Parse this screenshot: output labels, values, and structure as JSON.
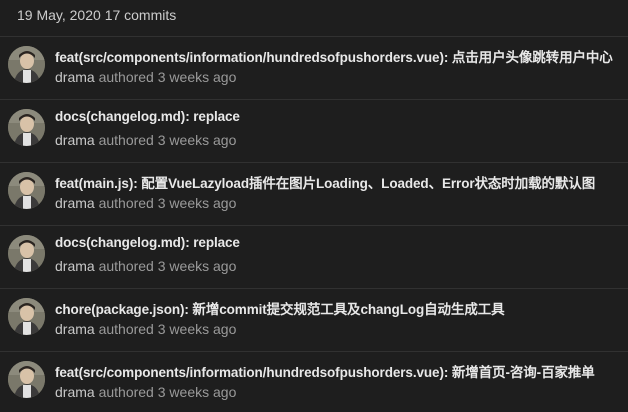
{
  "group": {
    "date": "19 May, 2020",
    "count": "17 commits"
  },
  "commits": [
    {
      "message": "feat(src/components/information/hundredsofpushorders.vue): 点击用户头像跳转用户中心",
      "author": "drama",
      "verb": "authored",
      "time": "3 weeks ago"
    },
    {
      "message": "docs(changelog.md): replace",
      "author": "drama",
      "verb": "authored",
      "time": "3 weeks ago"
    },
    {
      "message": "feat(main.js): 配置VueLazyload插件在图片Loading、Loaded、Error状态时加载的默认图",
      "author": "drama",
      "verb": "authored",
      "time": "3 weeks ago"
    },
    {
      "message": "docs(changelog.md): replace",
      "author": "drama",
      "verb": "authored",
      "time": "3 weeks ago"
    },
    {
      "message": "chore(package.json): 新增commit提交规范工具及changLog自动生成工具",
      "author": "drama",
      "verb": "authored",
      "time": "3 weeks ago"
    },
    {
      "message": "feat(src/components/information/hundredsofpushorders.vue): 新增首页-咨询-百家推单",
      "author": "drama",
      "verb": "authored",
      "time": "3 weeks ago"
    }
  ],
  "colors": {
    "background": "#1e1e1e",
    "divider": "#313131",
    "message": "#e8e8e8",
    "meta": "#9a9a9a"
  },
  "icons": {
    "avatar": "user-avatar-photo"
  }
}
